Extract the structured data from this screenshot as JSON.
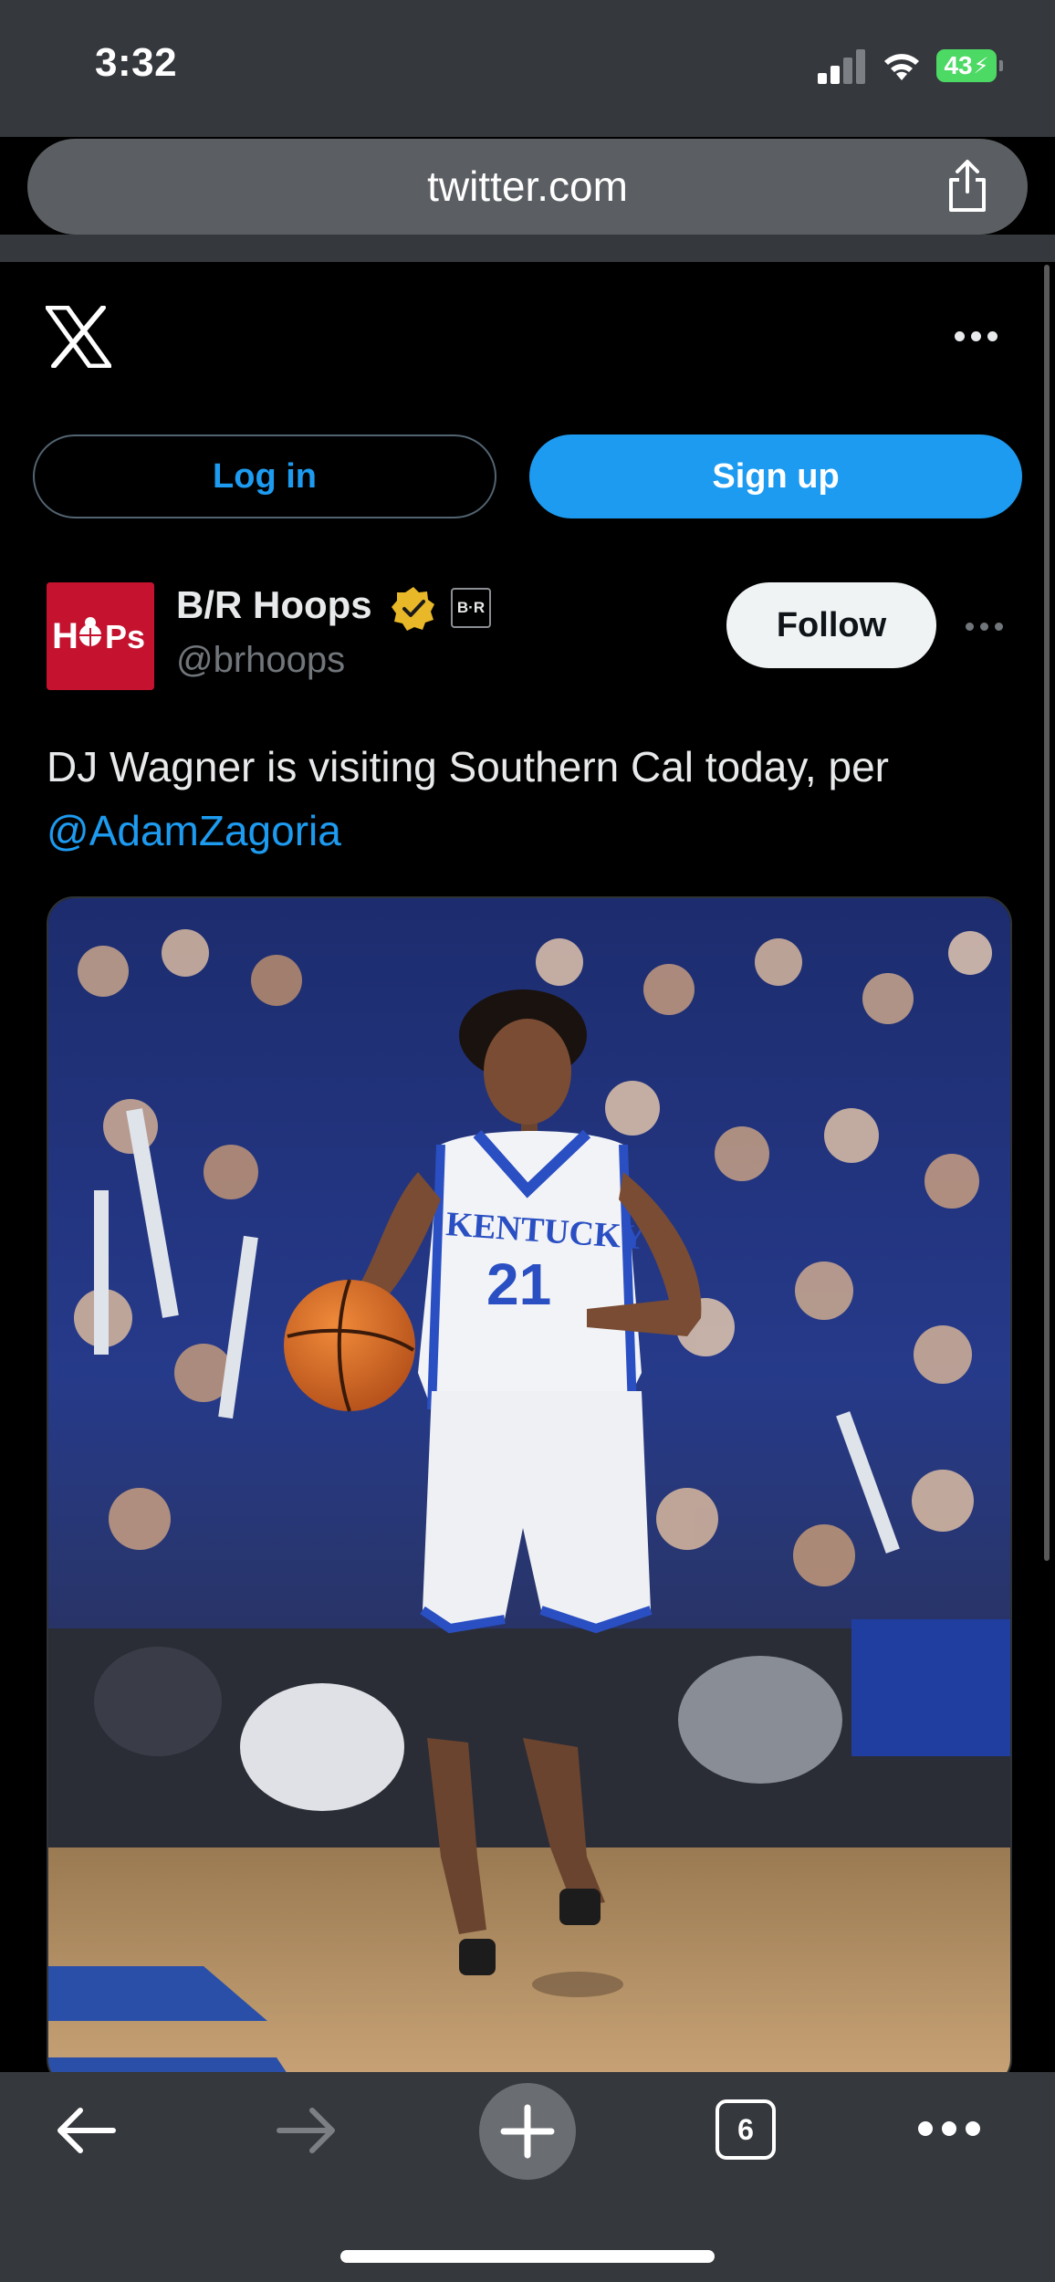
{
  "status_bar": {
    "time": "3:32",
    "battery": "43"
  },
  "browser": {
    "url": "twitter.com",
    "tab_count": "6"
  },
  "twitter": {
    "login_label": "Log in",
    "signup_label": "Sign up"
  },
  "tweet": {
    "author_name": "B/R Hoops",
    "author_handle": "@brhoops",
    "affiliate_badge": "B·R",
    "avatar_text": "HOOPS",
    "follow_label": "Follow",
    "text": "DJ Wagner is visiting Southern Cal today, per ",
    "mention": "@AdamZagoria",
    "photo": {
      "jersey_text": "KENTUCKY",
      "jersey_number": "21"
    }
  },
  "colors": {
    "accent": "#1d9bf0",
    "verified": "#e8b829",
    "battery": "#4cd964",
    "brand_red": "#c4122f"
  },
  "icons": {
    "logo": "x-logo-icon",
    "more": "more-horizontal-icon",
    "share": "share-icon",
    "back": "arrow-left-icon",
    "forward": "arrow-right-icon",
    "new_tab": "plus-icon",
    "verified": "verified-badge-icon"
  }
}
